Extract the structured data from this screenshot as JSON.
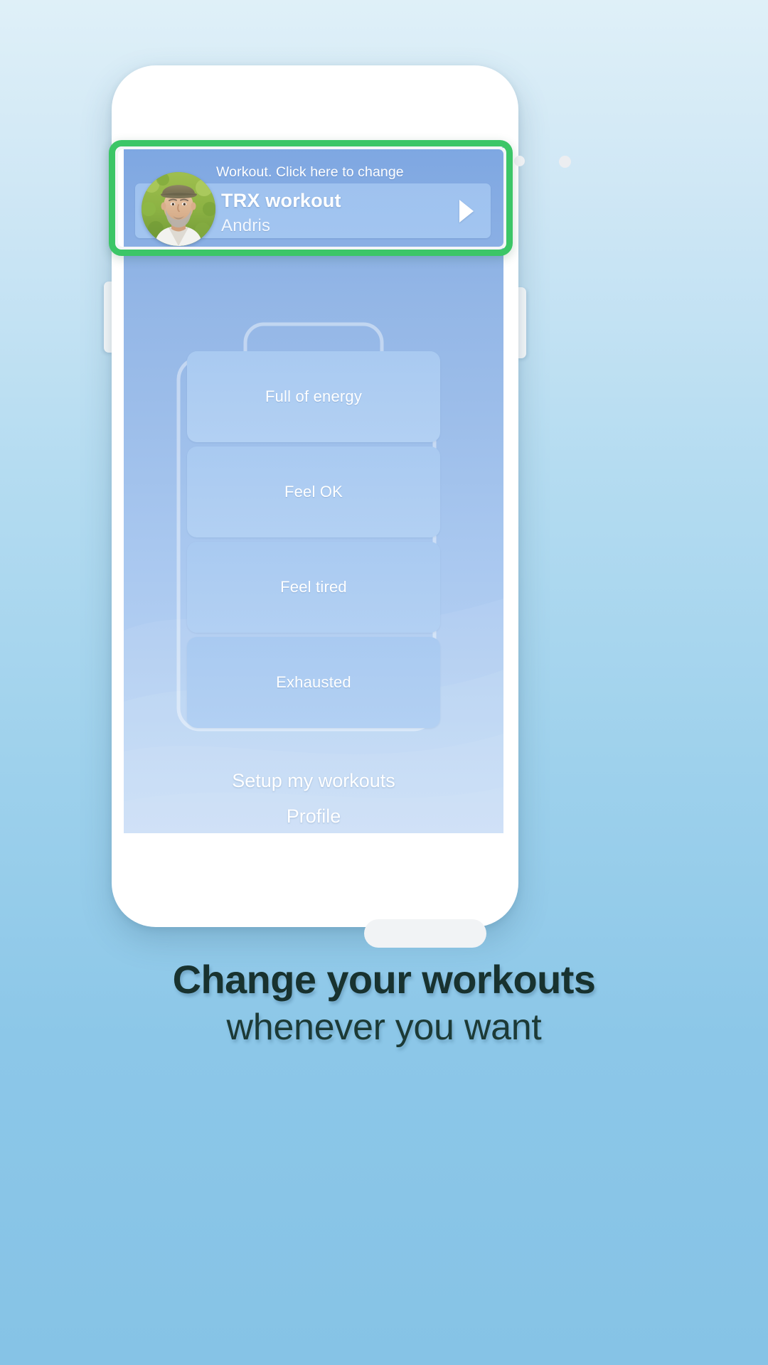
{
  "background": {
    "gradient_top": "#dff0f8",
    "gradient_bottom": "#86c3e6"
  },
  "highlight": {
    "color": "#3cc667",
    "target": "workout-selector-card"
  },
  "phone": {
    "frame_color": "#ffffff",
    "speaker_label": "earpiece-speaker",
    "home_button_label": "home-button"
  },
  "app": {
    "selector": {
      "hint": "Workout. Click here to change",
      "workout_name": "TRX workout",
      "user_name": "Andris",
      "chevron": "chevron-right-icon",
      "avatar_alt": "user-avatar"
    },
    "battery": {
      "shape": "battery-outline"
    },
    "energy_options": [
      {
        "label": "Full of energy"
      },
      {
        "label": "Feel OK"
      },
      {
        "label": "Feel tired"
      },
      {
        "label": "Exhausted"
      }
    ],
    "footer_links": [
      {
        "label": "Setup my workouts"
      },
      {
        "label": "Profile"
      }
    ]
  },
  "caption": {
    "line1": "Change your workouts",
    "line2": "whenever you want"
  }
}
